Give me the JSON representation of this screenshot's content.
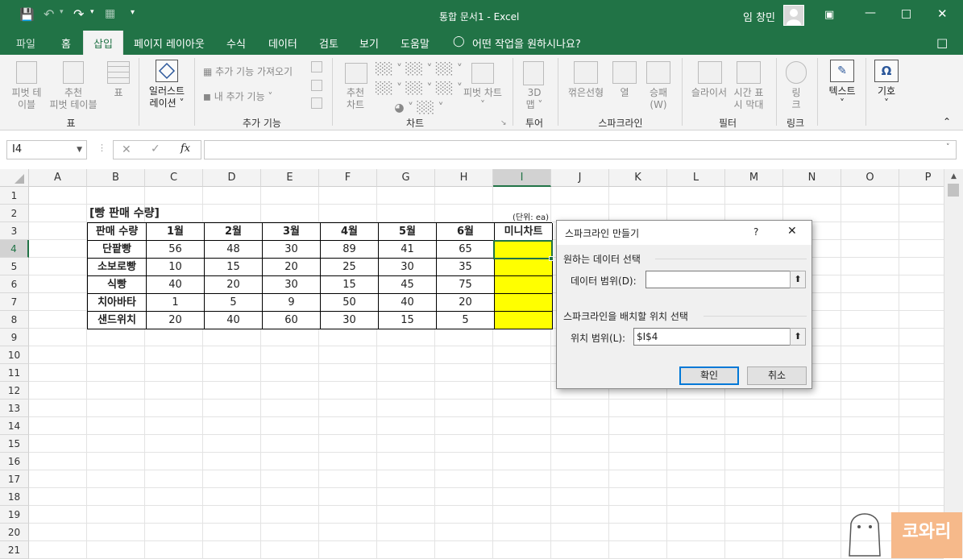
{
  "titlebar": {
    "title": "통합 문서1 - Excel",
    "user": "임 창민"
  },
  "tabs": [
    "파일",
    "홈",
    "삽입",
    "페이지 레이아웃",
    "수식",
    "데이터",
    "검토",
    "보기",
    "도움말"
  ],
  "tell_me": "어떤 작업을 원하시나요?",
  "ribbon": {
    "groups": {
      "tables": {
        "label": "표",
        "items": [
          "피벗 테\n이블",
          "추천\n피벗 테이블",
          "표"
        ]
      },
      "illustrations": {
        "label": "일러스트\n레이션"
      },
      "addins": {
        "label": "추가 기능",
        "get": "추가 기능 가져오기",
        "my": "내 추가 기능"
      },
      "charts": {
        "label": "차트",
        "recommended": "추천\n차트",
        "pivot": "피벗 차트"
      },
      "tours": {
        "label": "투어",
        "map3d": "3D\n맵"
      },
      "sparklines": {
        "label": "스파크라인",
        "line": "꺾은선형",
        "column": "열",
        "winloss": "승패\n(W)"
      },
      "filters": {
        "label": "필터",
        "slicer": "슬라이서",
        "timeline": "시간 표\n시 막대"
      },
      "links": {
        "label": "링크",
        "link": "링\n크"
      },
      "text": {
        "label": "텍스트"
      },
      "symbols": {
        "label": "기호"
      }
    }
  },
  "formula_bar": {
    "name_box": "I4",
    "fx": "fx"
  },
  "columns": [
    "A",
    "B",
    "C",
    "D",
    "E",
    "F",
    "G",
    "H",
    "I",
    "J",
    "K",
    "L",
    "M",
    "N",
    "O",
    "P"
  ],
  "rows": [
    "1",
    "2",
    "3",
    "4",
    "5",
    "6",
    "7",
    "8",
    "9",
    "10",
    "11",
    "12",
    "13",
    "14",
    "15",
    "16",
    "17",
    "18",
    "19",
    "20",
    "21"
  ],
  "sheet": {
    "title": "[빵 판매 수량]",
    "unit": "(단위: ea)",
    "headers": [
      "판매 수량",
      "1월",
      "2월",
      "3월",
      "4월",
      "5월",
      "6월",
      "미니차트"
    ],
    "data": [
      [
        "단팥빵",
        "56",
        "48",
        "30",
        "89",
        "41",
        "65"
      ],
      [
        "소보로빵",
        "10",
        "15",
        "20",
        "25",
        "30",
        "35"
      ],
      [
        "식빵",
        "40",
        "20",
        "30",
        "15",
        "45",
        "75"
      ],
      [
        "치아바타",
        "1",
        "5",
        "9",
        "50",
        "40",
        "20"
      ],
      [
        "샌드위치",
        "20",
        "40",
        "60",
        "30",
        "15",
        "5"
      ]
    ]
  },
  "dialog": {
    "title": "스파크라인 만들기",
    "help": "?",
    "section1": "원하는 데이터 선택",
    "data_range_label": "데이터 범위(D):",
    "data_range_value": "",
    "section2": "스파크라인을 배치할 위치 선택",
    "location_label": "위치 범위(L):",
    "location_value": "$I$4",
    "ok": "확인",
    "cancel": "취소"
  },
  "watermark": "코와리",
  "colors": {
    "excel_green": "#217346",
    "highlight": "#ffff00",
    "dialog_blue": "#0078d7"
  }
}
